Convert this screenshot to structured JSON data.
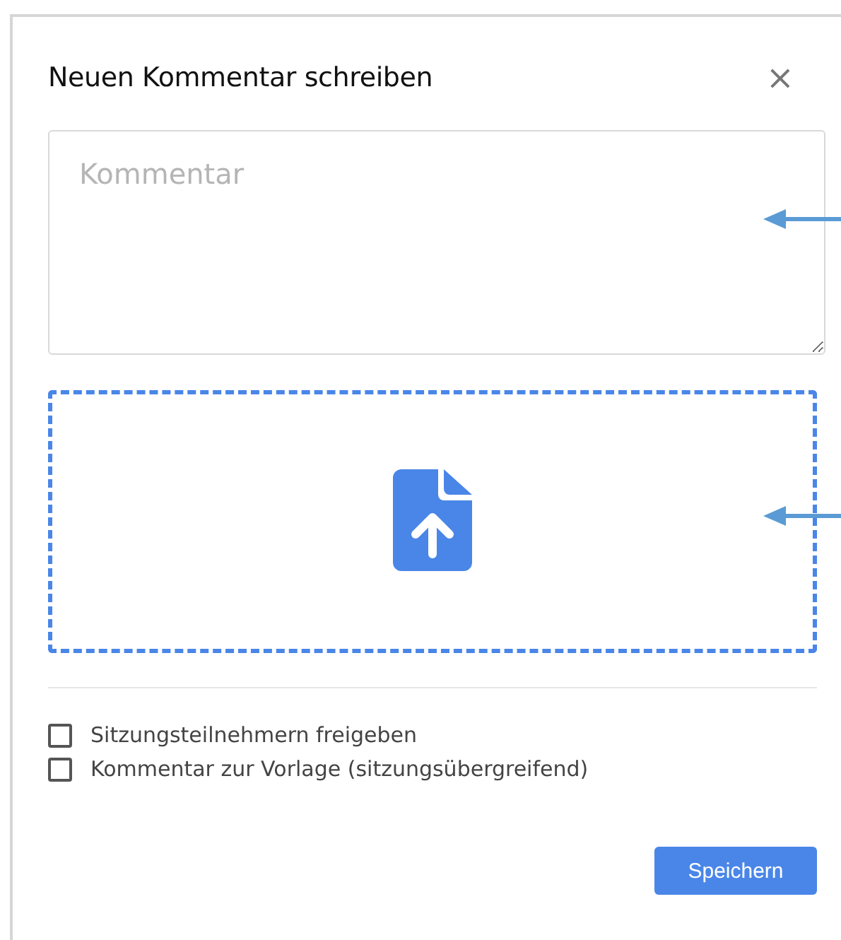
{
  "dialog": {
    "title": "Neuen Kommentar schreiben",
    "close": "×"
  },
  "comment": {
    "placeholder": "Kommentar"
  },
  "options": [
    {
      "label": "Sitzungsteilnehmern freigeben",
      "checked": false
    },
    {
      "label": "Kommentar zur Vorlage (sitzungsübergreifend)",
      "checked": false
    }
  ],
  "buttons": [
    "Speichern"
  ]
}
